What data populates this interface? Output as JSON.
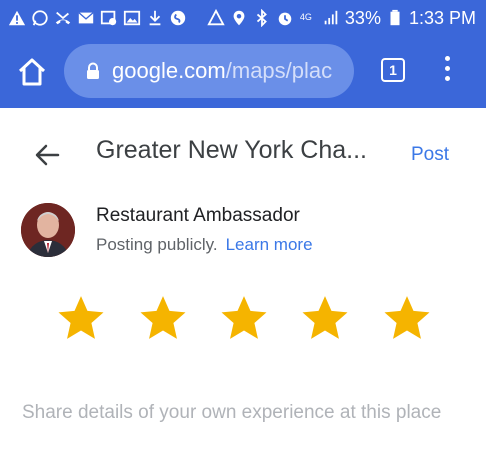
{
  "status_bar": {
    "battery": "33%",
    "time": "1:33 PM",
    "left_icons": [
      "alert-icon",
      "whatsapp-icon",
      "missed-call-icon",
      "mail-icon",
      "image-settings-icon",
      "gallery-icon",
      "download-icon",
      "shazam-icon"
    ],
    "right_icons": [
      "data-saver-icon",
      "location-icon",
      "bluetooth-icon",
      "alarm-icon",
      "lte-icon",
      "signal-icon",
      "battery-icon"
    ]
  },
  "browser": {
    "url_domain": "google.com",
    "url_path": "/maps/plac",
    "tab_count": "1"
  },
  "header": {
    "title": "Greater New York Cha...",
    "post_label": "Post"
  },
  "user": {
    "name": "Restaurant Ambassador",
    "posting_status": "Posting publicly.",
    "learn_more": "Learn more"
  },
  "rating": {
    "max": 5,
    "selected": 5,
    "star_color": "#f5b400"
  },
  "review": {
    "placeholder": "Share details of your own experience at this place"
  },
  "colors": {
    "toolbar": "#3b67d9",
    "link": "#3b78e7"
  }
}
